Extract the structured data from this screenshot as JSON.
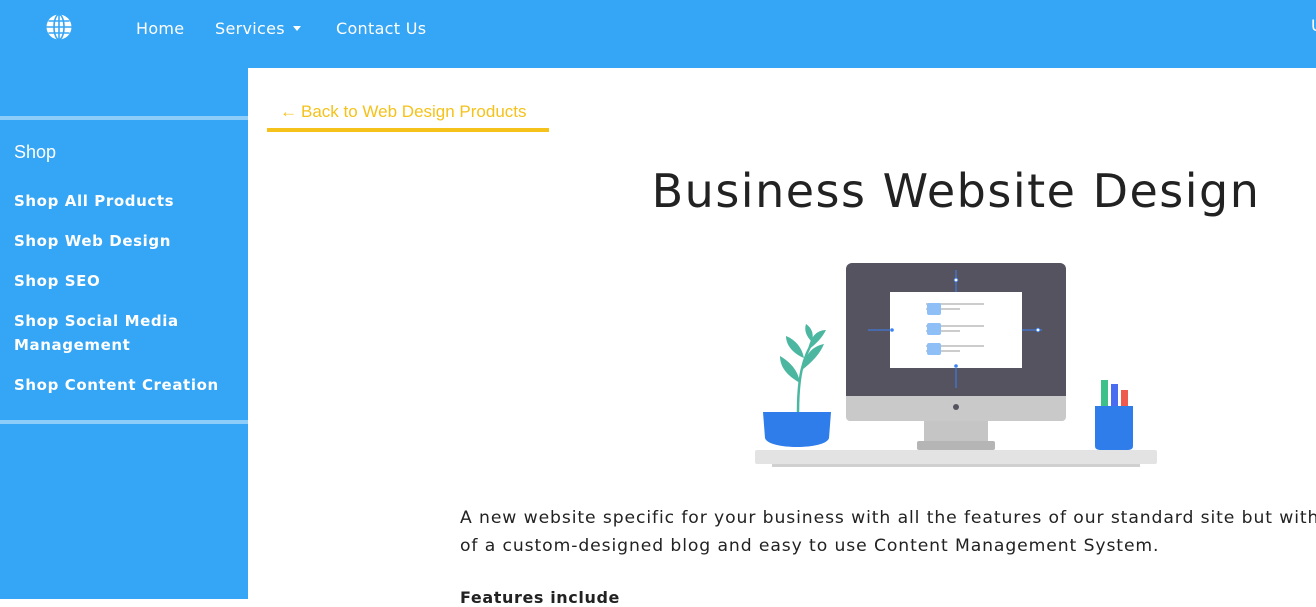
{
  "nav": {
    "logo_icon": "globe-icon",
    "items": [
      {
        "label": "Home"
      },
      {
        "label": "Services",
        "dropdown": true
      },
      {
        "label": "Contact Us"
      }
    ],
    "edge_text": "U"
  },
  "sidebar": {
    "heading": "Shop",
    "items": [
      {
        "label": "Shop All Products"
      },
      {
        "label": "Shop Web Design"
      },
      {
        "label": "Shop SEO"
      },
      {
        "label": "Shop Social Media Management"
      },
      {
        "label": "Shop Content Creation"
      }
    ]
  },
  "main": {
    "back_link": "Back to Web Design Products",
    "back_icon": "arrow-left-icon",
    "title": "Business Website Design",
    "illustration": "desktop-computer-with-plant-and-pencil-cup",
    "description_line1": "A new website specific for your business with all the features of our standard site but with",
    "description_line2": "of a custom-designed blog and easy to use Content Management System.",
    "features_heading": "Features include"
  },
  "colors": {
    "brand_blue": "#35a5f5",
    "accent_yellow": "#f4c21b",
    "text_dark": "#222222"
  }
}
